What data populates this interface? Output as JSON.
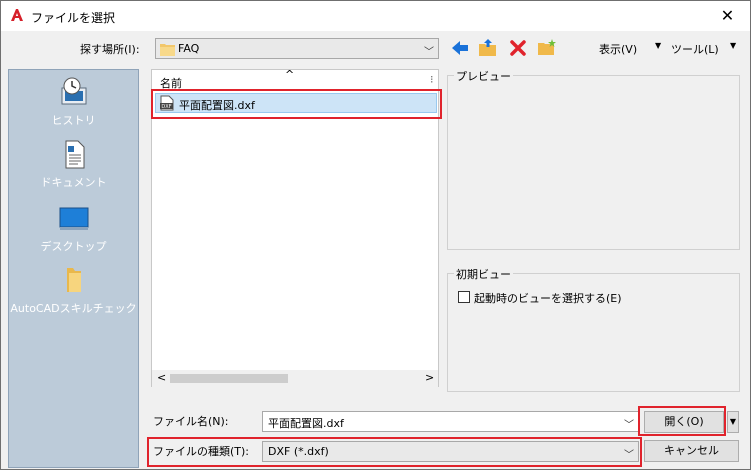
{
  "window": {
    "title": "ファイルを選択",
    "close_glyph": "✕"
  },
  "lookin": {
    "label": "探す場所(I):",
    "value": "FAQ"
  },
  "toolbar": {
    "view_label": "表示(V)",
    "tools_label": "ツール(L)",
    "dropdown_glyph": "▼"
  },
  "places": [
    {
      "label": "ヒストリ",
      "icon": "history-icon"
    },
    {
      "label": "ドキュメント",
      "icon": "documents-icon"
    },
    {
      "label": "デスクトップ",
      "icon": "desktop-icon"
    },
    {
      "label": "AutoCADスキルチェック",
      "icon": "folder-icon"
    }
  ],
  "filelist": {
    "column_header": "名前",
    "sort_glyph": "^",
    "files": [
      {
        "name": "平面配置図.dxf",
        "icon": "dxf-file-icon",
        "icon_text": "DXF"
      }
    ],
    "scroll_left": "<",
    "scroll_right": ">"
  },
  "preview": {
    "title": "プレビュー"
  },
  "initial_view": {
    "title": "初期ビュー",
    "checkbox_label": "起動時のビューを選択する(E)",
    "checked": false
  },
  "filename": {
    "label": "ファイル名(N):",
    "value": "平面配置図.dxf"
  },
  "filetype": {
    "label": "ファイルの種類(T):",
    "value": "DXF (*.dxf)"
  },
  "buttons": {
    "open": "開く(O)",
    "cancel": "キャンセル",
    "open_menu_glyph": "▼"
  },
  "colors": {
    "highlight": "#e0232c",
    "selection": "#cde4f7",
    "places_bg": "#bccbd9"
  }
}
